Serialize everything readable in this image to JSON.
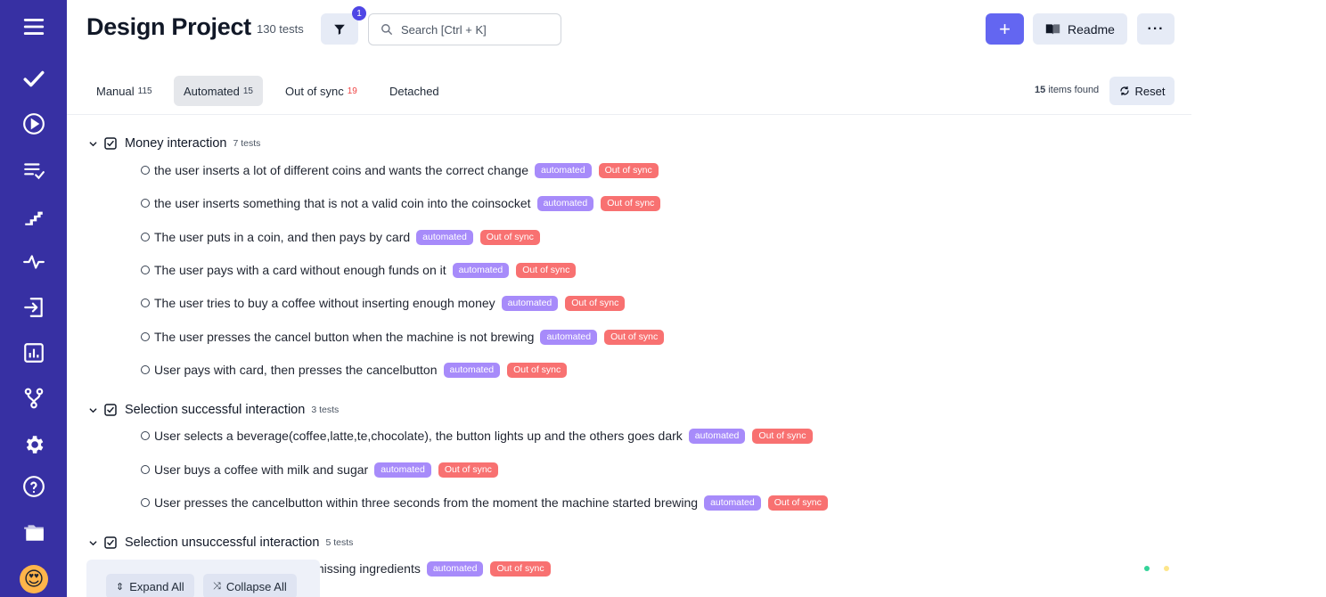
{
  "header": {
    "title": "Design Project",
    "count": "130 tests",
    "filter_badge": "1",
    "search_placeholder": "Search [Ctrl + K]",
    "plus_label": "+",
    "readme_label": "Readme",
    "more_label": "···"
  },
  "tabs": [
    {
      "label": "Manual",
      "count": "115"
    },
    {
      "label": "Automated",
      "count": "15"
    },
    {
      "label": "Out of sync",
      "count": "19"
    },
    {
      "label": "Detached",
      "count": ""
    }
  ],
  "results": {
    "count": "15",
    "suffix": "items found",
    "reset_label": "Reset"
  },
  "tags": {
    "automated": "automated",
    "out_of_sync": "Out of sync"
  },
  "groups": [
    {
      "name": "Money interaction",
      "count": "7 tests",
      "tests": [
        "the user inserts a lot of different coins and wants the correct change",
        "the user inserts something that is not a valid coin into the coinsocket",
        "The user puts in a coin, and then pays by card",
        "The user pays with a card without enough funds on it",
        "The user tries to buy a coffee without inserting enough money",
        "The user presses the cancel button when the machine is not brewing",
        "User pays with card, then presses the cancelbutton"
      ]
    },
    {
      "name": "Selection successful interaction",
      "count": "3 tests",
      "tests": [
        "User selects a beverage(coffee,latte,te,chocolate), the button lights up and the others goes dark",
        "User buys a coffee with milk and sugar",
        "User presses the cancelbutton within three seconds from the moment the machine started brewing"
      ]
    },
    {
      "name": "Selection unsuccessful interaction",
      "count": "5 tests",
      "tests": [
        "missing ingredients"
      ]
    }
  ],
  "bottom": {
    "expand_label": "Expand All",
    "collapse_label": "Collapse All"
  }
}
